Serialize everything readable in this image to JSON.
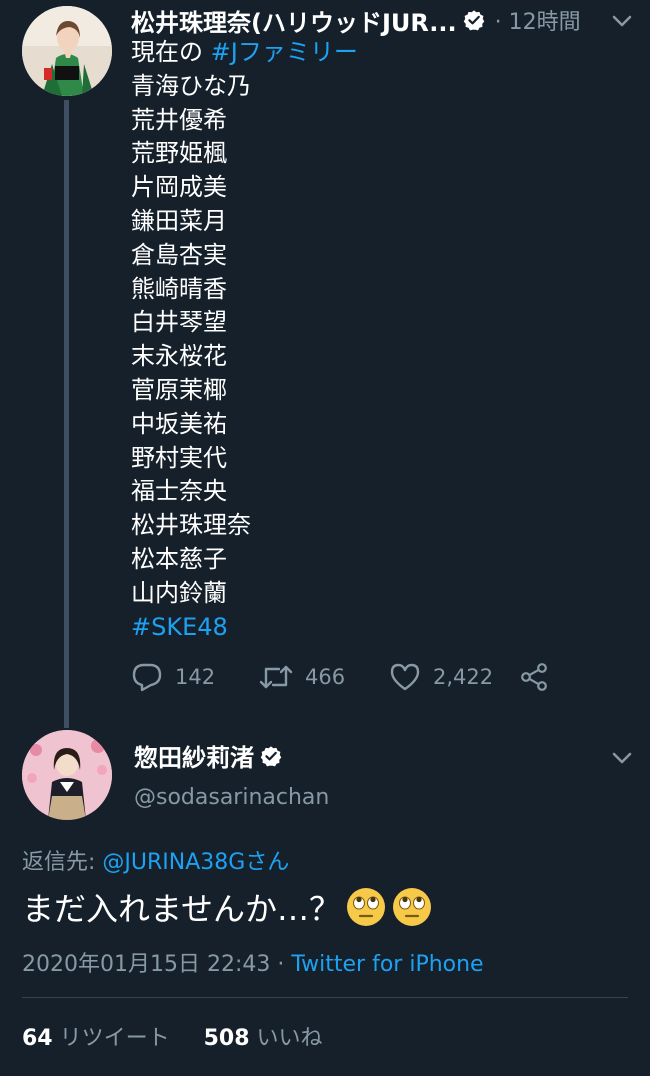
{
  "tweet1": {
    "author_name": "松井珠理奈(ハリウッドJUR...",
    "time": "· 12時間",
    "lines": [
      "現在の ",
      "青海ひな乃",
      "荒井優希",
      "荒野姫楓",
      "片岡成美",
      "鎌田菜月",
      "倉島杏実",
      "熊崎晴香",
      "白井琴望",
      "末永桜花",
      "菅原茉椰",
      "中坂美祐",
      "野村実代",
      "福士奈央",
      "松井珠理奈",
      "松本慈子",
      "山内鈴蘭"
    ],
    "hashtag_family": "#Jファミリー",
    "hashtag_ske": "#SKE48",
    "reply_count": "142",
    "retweet_count": "466",
    "like_count": "2,422"
  },
  "tweet2": {
    "author_name": "惣田紗莉渚",
    "handle": "@sodasarinachan",
    "reply_prefix": "返信先: ",
    "reply_mention": "@JURINA38Gさん",
    "text": "まだ入れませんか…？",
    "datetime": "2020年01月15日 22:43 · ",
    "source": "Twitter for iPhone",
    "retweets_num": "64",
    "retweets_label": " リツイート",
    "likes_num": "508",
    "likes_label": " いいね"
  },
  "icons": {
    "verified": "verified-badge-icon",
    "chevron": "chevron-down-icon",
    "reply": "reply-icon",
    "retweet": "retweet-icon",
    "like": "heart-icon",
    "share": "share-icon",
    "emoji": "rolling-eyes-emoji"
  },
  "colors": {
    "background": "#15202b",
    "accent": "#1da1f2",
    "secondary_text": "#8899a6"
  }
}
